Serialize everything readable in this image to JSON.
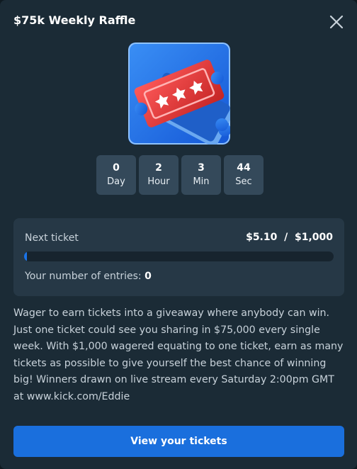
{
  "modal": {
    "title": "$75k Weekly Raffle",
    "close_icon": "close-icon",
    "hero_icon": "raffle-tickets-icon"
  },
  "countdown": [
    {
      "value": "0",
      "unit": "Day"
    },
    {
      "value": "2",
      "unit": "Hour"
    },
    {
      "value": "3",
      "unit": "Min"
    },
    {
      "value": "44",
      "unit": "Sec"
    }
  ],
  "progress": {
    "label": "Next ticket",
    "amount": "$5.10  /  $1,000",
    "fraction": 0.0051,
    "entries_label": "Your number of entries:",
    "entries_value": "0"
  },
  "description": "Wager to earn tickets into a giveaway where anybody can win. Just one ticket could see you sharing in $75,000 every single week. With $1,000 wagered equating to one ticket, earn as many tickets as possible to give yourself the best chance of winning big! Winners drawn on live stream every Saturday 2:00pm GMT at www.kick.com/Eddie",
  "cta": {
    "label": "View your tickets"
  },
  "colors": {
    "modal_bg": "#1b2b36",
    "card_bg": "#263846",
    "accent": "#1a6fdd",
    "ticket_red": "#e53a3a",
    "ticket_blue": "#1f5fc8"
  }
}
